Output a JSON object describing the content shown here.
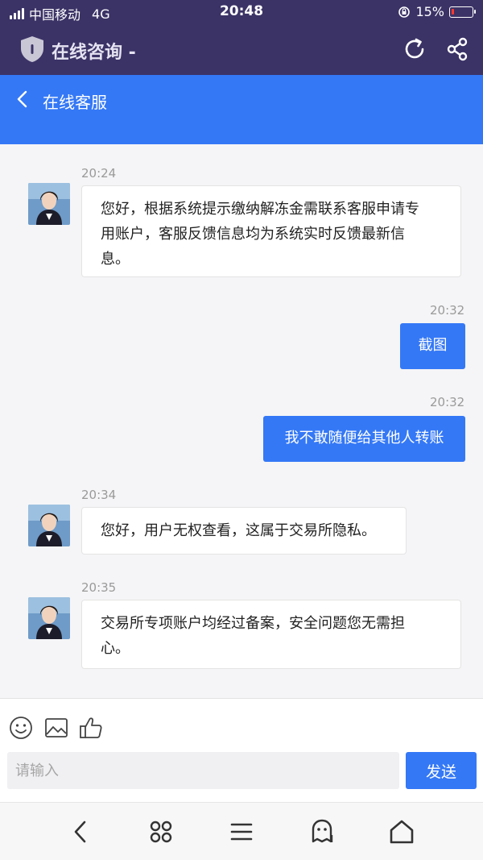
{
  "status_bar": {
    "carrier": "中国移动",
    "network": "4G",
    "time": "20:48",
    "battery": "15%",
    "battery_level": 0.15
  },
  "browser_bar": {
    "title": "在线咨询 -",
    "icons": [
      "shield-icon",
      "refresh-icon",
      "share-icon"
    ]
  },
  "header": {
    "title": "在线客服",
    "back_icon": "chevron-left-icon"
  },
  "messages": [
    {
      "side": "in",
      "time": "20:24",
      "lines": [
        "您好，根据系统提示缴纳解冻金需联系客服申请专",
        "用账户，客服反馈信息均为系统实时反馈最新信",
        "息。"
      ]
    },
    {
      "side": "out",
      "time": "20:32",
      "text": "截图"
    },
    {
      "side": "out",
      "time": "20:32",
      "text": "我不敢随便给其他人转账"
    },
    {
      "side": "in",
      "time": "20:34",
      "lines": [
        "您好，用户无权查看，这属于交易所隐私。"
      ]
    },
    {
      "side": "in",
      "time": "20:35",
      "lines": [
        "交易所专项账户均经过备案，安全问题您无需担",
        "心。"
      ]
    }
  ],
  "compose": {
    "placeholder": "请输入",
    "value": "",
    "send_label": "发送",
    "tools": [
      "emoji-icon",
      "image-icon",
      "thumbs-up-icon"
    ]
  },
  "bottom_nav": {
    "items": [
      "back-icon",
      "tabs-icon",
      "menu-icon",
      "ghost-icon",
      "home-icon"
    ]
  },
  "colors": {
    "accent": "#3478f6",
    "topbar": "#3b3366",
    "background": "#f5f5f7"
  }
}
